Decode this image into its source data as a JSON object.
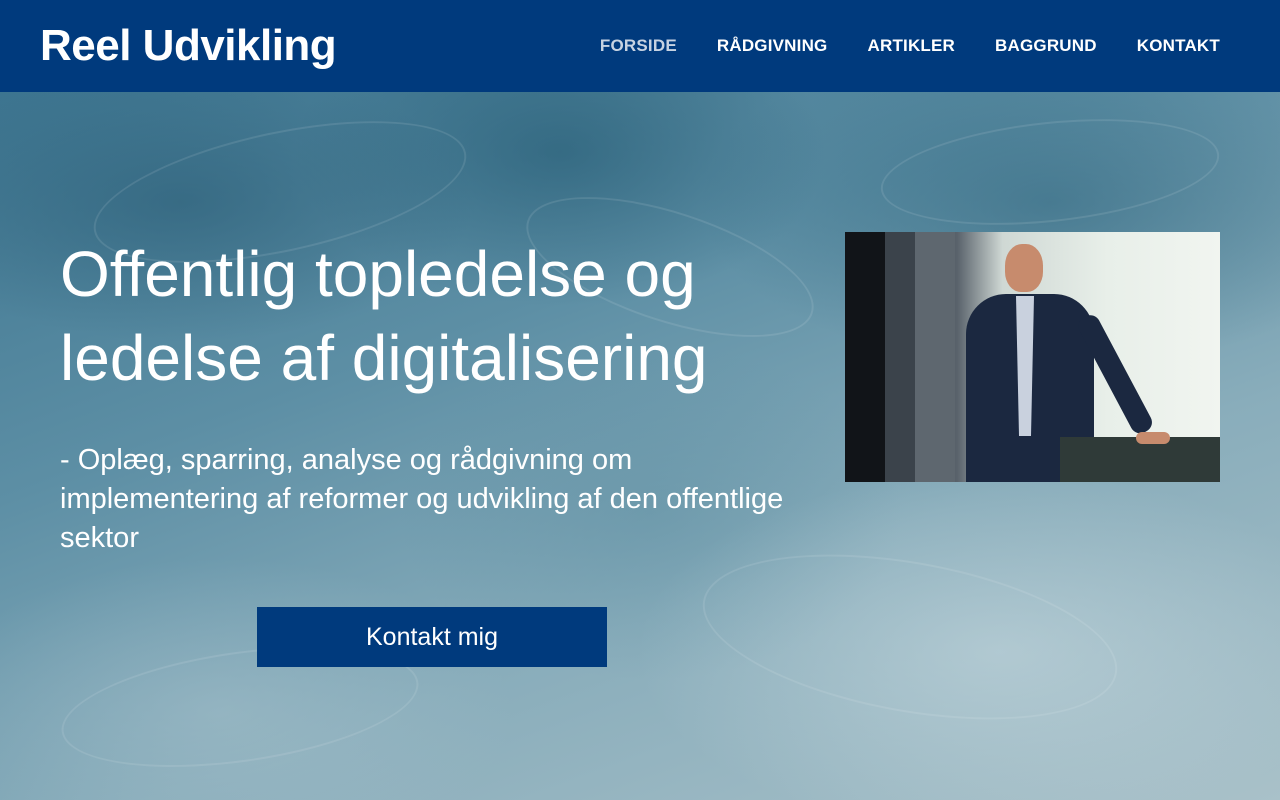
{
  "site": {
    "logo": "Reel Udvikling"
  },
  "nav": {
    "items": [
      {
        "label": "FORSIDE",
        "active": true
      },
      {
        "label": "RÅDGIVNING",
        "active": false
      },
      {
        "label": "ARTIKLER",
        "active": false
      },
      {
        "label": "BAGGRUND",
        "active": false
      },
      {
        "label": "KONTAKT",
        "active": false
      }
    ]
  },
  "hero": {
    "title": "Offentlig topledelse og ledelse af digitalisering",
    "subtitle": "- Oplæg, sparring, analyse og rådgivning om implementering af reformer og udvikling af den offentlige sektor",
    "cta_label": "Kontakt mig"
  },
  "colors": {
    "header_bg": "#003a7d",
    "button_bg": "#003a7d",
    "text": "#ffffff"
  }
}
